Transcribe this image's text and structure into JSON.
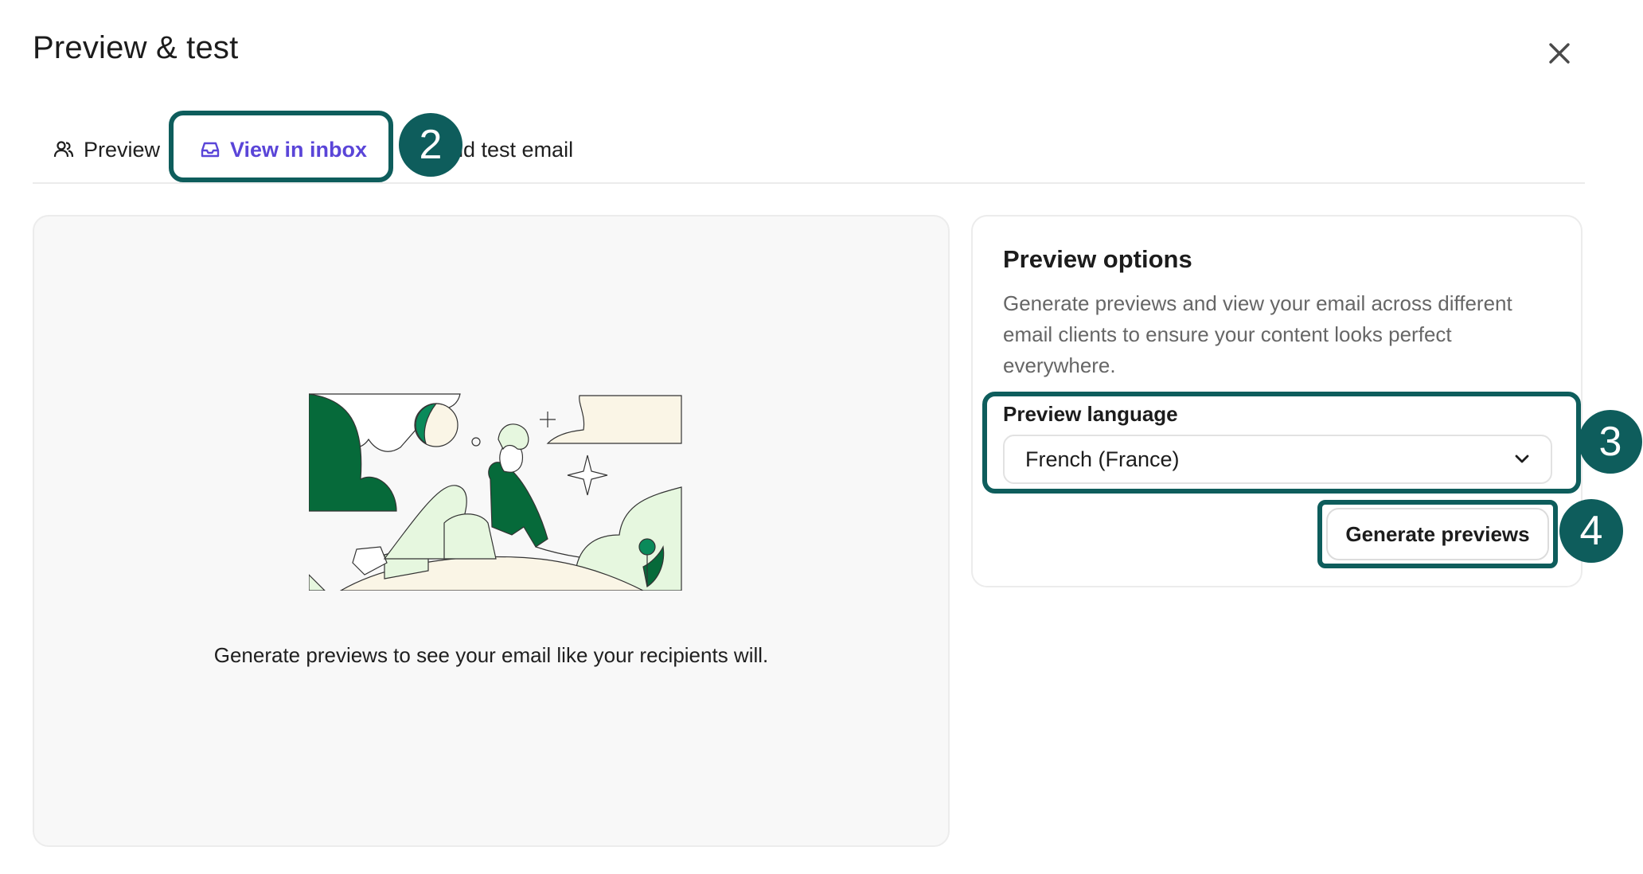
{
  "dialog": {
    "title": "Preview & test"
  },
  "tabs": [
    {
      "label": "Preview",
      "icon": "users-icon",
      "active": false
    },
    {
      "label": "View in inbox",
      "icon": "inbox-icon",
      "active": true
    },
    {
      "label": "Send test email",
      "icon": "send-icon",
      "active": false
    }
  ],
  "send_tab_visible_text": "nd test email",
  "annotations": {
    "step_view_inbox": "2",
    "step_language": "3",
    "step_generate": "4"
  },
  "main": {
    "empty_message": "Generate previews to see your email like your recipients will."
  },
  "options": {
    "title": "Preview options",
    "description": "Generate previews and view your email across different email clients to ensure your content looks perfect everywhere.",
    "language_label": "Preview language",
    "language_value": "French (France)",
    "generate_label": "Generate previews"
  },
  "colors": {
    "accent_purple": "#5a45d8",
    "annotation_teal": "#0e5d5c",
    "illustration_dark_green": "#066a3a",
    "illustration_light_green": "#e6f7df",
    "illustration_cream": "#faf5e6"
  }
}
